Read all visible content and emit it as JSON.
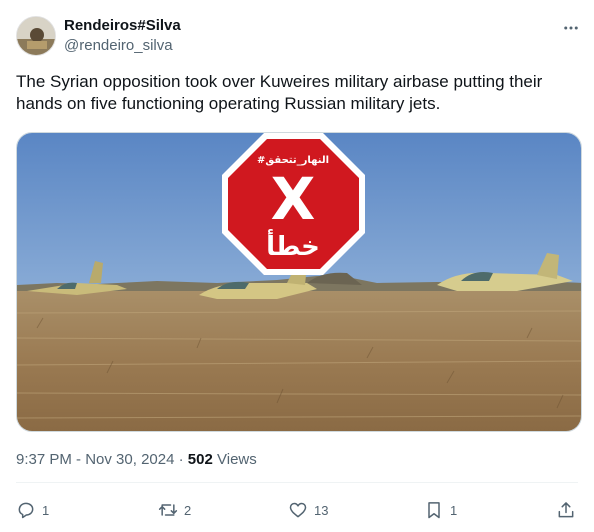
{
  "author": {
    "display_name": "Rendeiros#Silva",
    "handle": "@rendeiro_silva",
    "avatar_icon": "avatar-image"
  },
  "tweet": {
    "text": "The Syrian opposition took over Kuweires military airbase putting their hands on five functioning operating Russian military jets."
  },
  "media": {
    "stamp_tag": "#النهار_تتحقق",
    "stamp_verdict": "خطأ",
    "stamp_mark": "X",
    "stamp_color": "#d0181f"
  },
  "meta": {
    "time": "9:37 PM",
    "date": "Nov 30, 2024",
    "separator": "·",
    "views_count": "502",
    "views_label": "Views"
  },
  "actions": {
    "replies": "1",
    "reposts": "2",
    "likes": "13",
    "bookmarks": "1"
  },
  "icons": [
    "more-icon",
    "reply-icon",
    "repost-icon",
    "like-icon",
    "bookmark-icon",
    "share-icon"
  ]
}
